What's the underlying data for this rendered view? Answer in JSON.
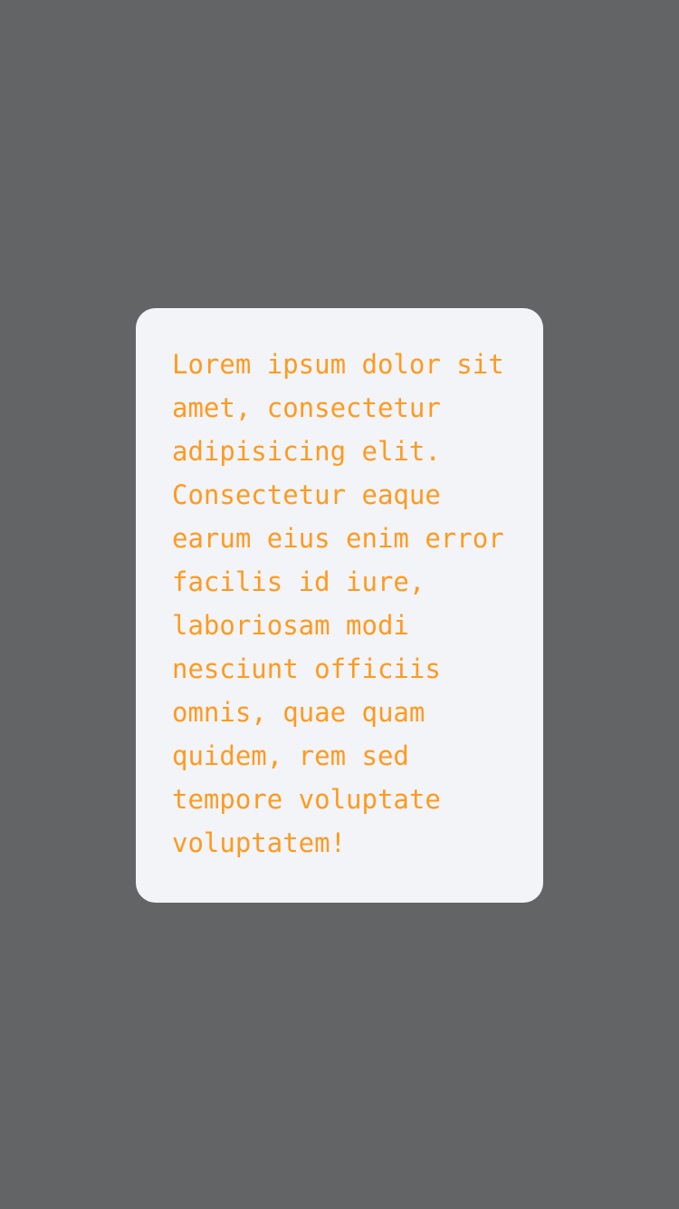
{
  "colors": {
    "overlay_background": "#636466",
    "card_background": "#f3f4f8",
    "text_color": "#ff9a1f"
  },
  "card": {
    "lines": [
      "Lorem ipsum dolor sit",
      "amet, consectetur",
      "adipisicing elit.",
      "Consectetur eaque",
      "earum eius enim error",
      "facilis id iure,",
      "laboriosam modi",
      "nesciunt officiis",
      "omnis, quae quam",
      "quidem, rem sed",
      "tempore voluptate",
      "voluptatem!"
    ]
  }
}
